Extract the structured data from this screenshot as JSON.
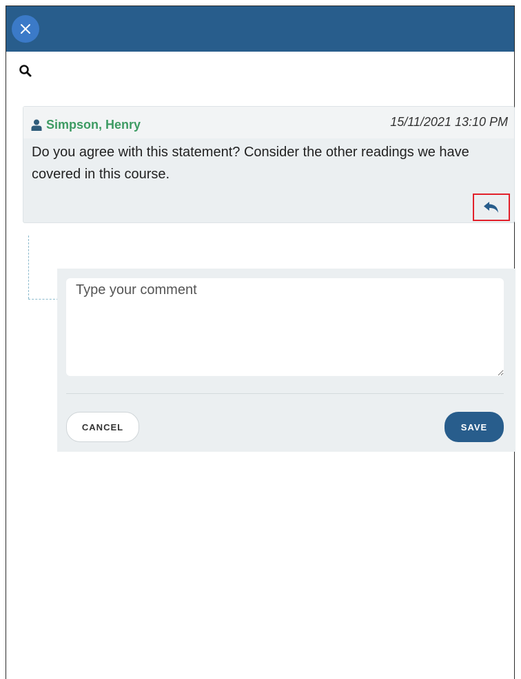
{
  "header": {
    "close_icon": "close-icon"
  },
  "toolbar": {
    "search_icon": "search-icon"
  },
  "comment": {
    "author": "Simpson, Henry",
    "author_icon": "user-icon",
    "timestamp": "15/11/2021 13:10 PM",
    "text": "Do you agree with this statement? Consider the other readings we have covered in this course.",
    "reply_icon": "reply-icon"
  },
  "reply_form": {
    "value": "",
    "placeholder": "Type your comment",
    "cancel_label": "CANCEL",
    "save_label": "SAVE"
  },
  "colors": {
    "header_bg": "#285d8c",
    "close_button_bg": "#3b7ac8",
    "author_color": "#3d9b63",
    "highlight_border": "#e2202a"
  }
}
